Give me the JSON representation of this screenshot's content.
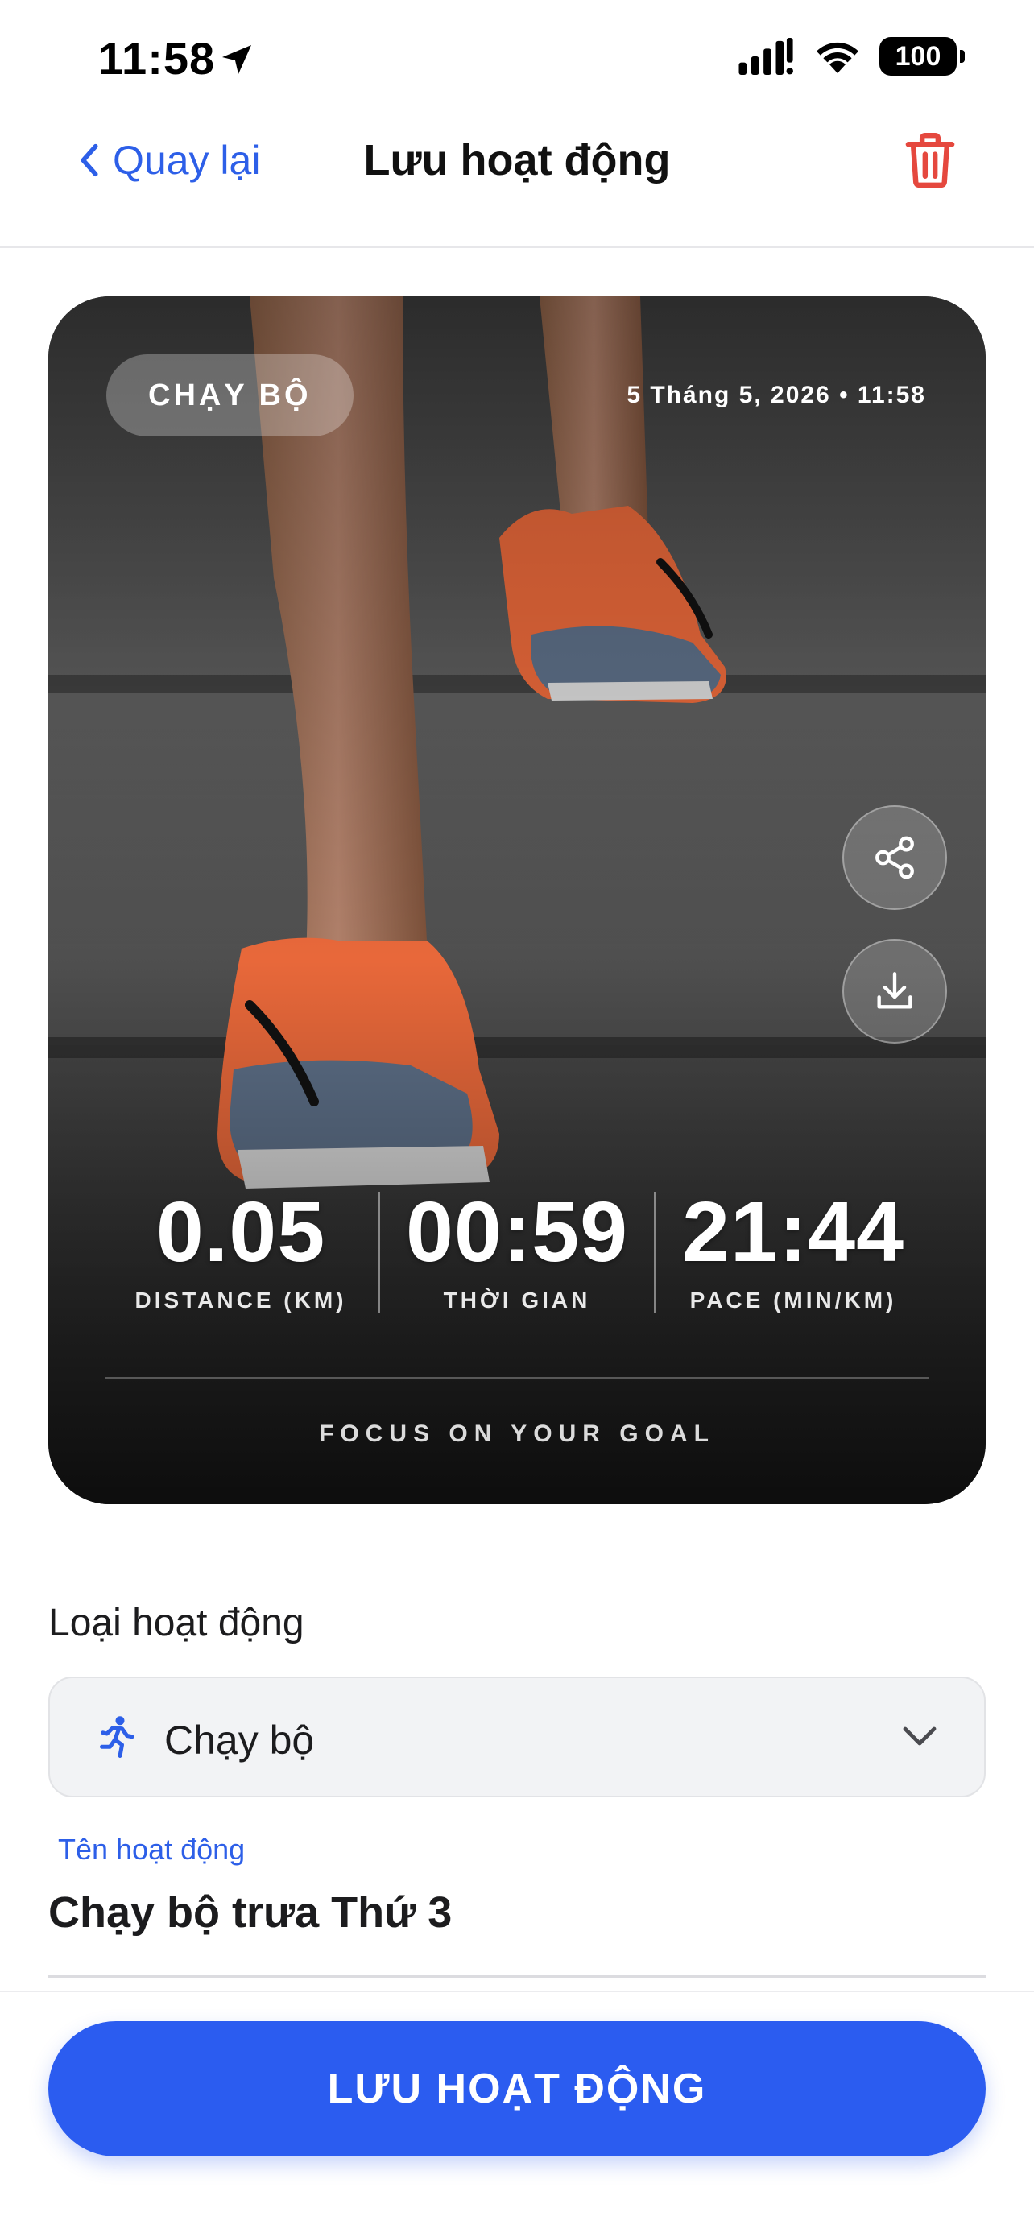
{
  "status_bar": {
    "time": "11:58",
    "battery": "100"
  },
  "nav": {
    "back_label": "Quay lại",
    "title": "Lưu hoạt động"
  },
  "card": {
    "chip": "CHẠY BỘ",
    "date": "5 Tháng 5, 2026 • 11:58",
    "stats": [
      {
        "value": "0.05",
        "label": "DISTANCE (KM)"
      },
      {
        "value": "00:59",
        "label": "THỜI GIAN"
      },
      {
        "value": "21:44",
        "label": "PACE (MIN/KM)"
      }
    ],
    "slogan": "FOCUS ON YOUR GOAL"
  },
  "form": {
    "activity_type_label": "Loại hoạt động",
    "activity_type_value": "Chạy bộ",
    "activity_name_label": "Tên hoạt động",
    "activity_name_value": "Chạy bộ trưa Thứ 3"
  },
  "footer": {
    "save_label": "LƯU HOẠT ĐỘNG"
  },
  "colors": {
    "accent": "#2b5cf0",
    "link": "#2d5fe8",
    "danger": "#e5483e"
  }
}
